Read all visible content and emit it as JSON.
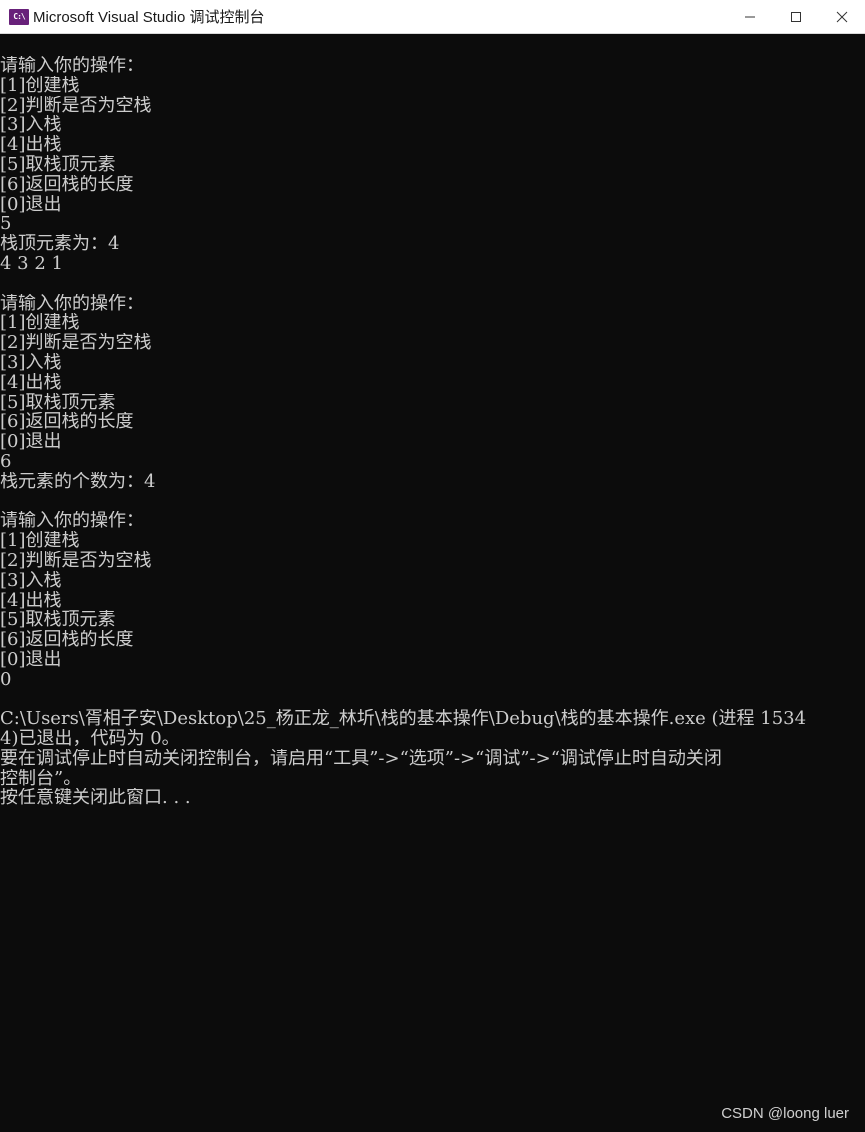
{
  "window": {
    "title": "Microsoft Visual Studio 调试控制台",
    "icon_text": "C:\\"
  },
  "console": {
    "lines": [
      "请输入你的操作：",
      "[1]创建栈",
      "[2]判断是否为空栈",
      "[3]入栈",
      "[4]出栈",
      "[5]取栈顶元素",
      "[6]返回栈的长度",
      "[0]退出",
      "5",
      "栈顶元素为：4",
      "4 3 2 1",
      "",
      "请输入你的操作：",
      "[1]创建栈",
      "[2]判断是否为空栈",
      "[3]入栈",
      "[4]出栈",
      "[5]取栈顶元素",
      "[6]返回栈的长度",
      "[0]退出",
      "6",
      "栈元素的个数为：4",
      "",
      "请输入你的操作：",
      "[1]创建栈",
      "[2]判断是否为空栈",
      "[3]入栈",
      "[4]出栈",
      "[5]取栈顶元素",
      "[6]返回栈的长度",
      "[0]退出",
      "0",
      "",
      "C:\\Users\\胥相子安\\Desktop\\25_杨正龙_林圻\\栈的基本操作\\Debug\\栈的基本操作.exe (进程 1534",
      "4)已退出，代码为 0。",
      "要在调试停止时自动关闭控制台，请启用“工具”->“选项”->“调试”->“调试停止时自动关闭",
      "控制台”。",
      "按任意键关闭此窗口. . ."
    ]
  },
  "watermark": "CSDN @loong luer",
  "icons": {
    "minimize": "minimize-icon",
    "maximize": "maximize-icon",
    "close": "close-icon"
  }
}
